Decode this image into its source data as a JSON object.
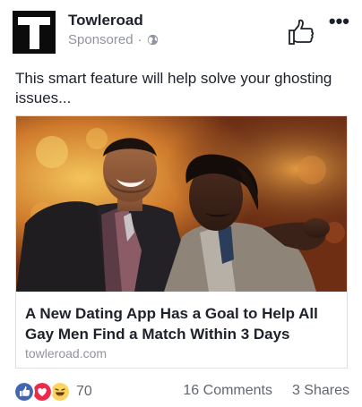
{
  "post": {
    "page_name": "Towleroad",
    "sponsored_label": "Sponsored",
    "separator": "·",
    "text": "This smart feature will help solve your ghosting issues...",
    "more_icon": "more-options-icon",
    "like_icon": "thumbs-up-icon"
  },
  "link_card": {
    "title": "A New Dating App Has a Goal to Help All Gay Men Find a Match Within 3 Days",
    "domain": "towleroad.com",
    "image": "photo of two smiling men embracing"
  },
  "engagement": {
    "reaction_icons": [
      "like-reaction-icon",
      "love-reaction-icon",
      "haha-reaction-icon"
    ],
    "reaction_count": "70",
    "comments": "16 Comments",
    "shares": "3 Shares"
  },
  "colors": {
    "like_blue": "#4267b2",
    "love_red": "#f0284a",
    "haha_yellow": "#fcd45c",
    "meta_gray": "#90949c"
  }
}
